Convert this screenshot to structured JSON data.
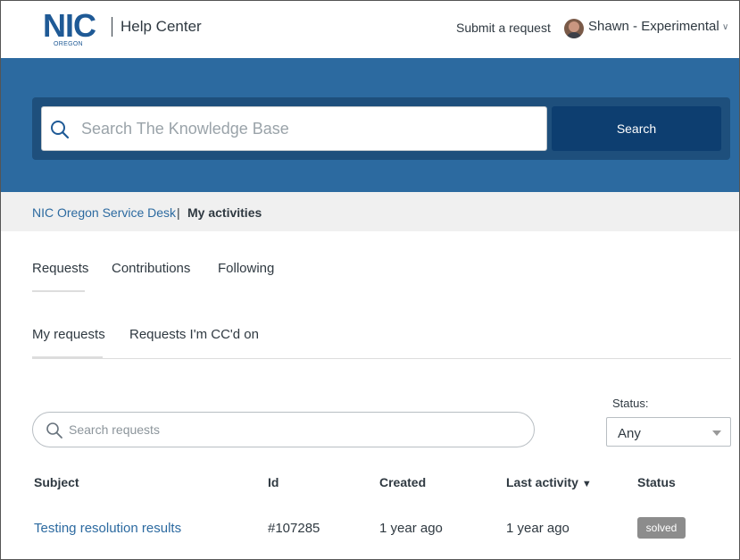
{
  "header": {
    "logo_text": "NIC",
    "logo_sub": "OREGON",
    "title": "Help Center",
    "submit_request": "Submit a request",
    "user_name": "Shawn - Experimental"
  },
  "hero": {
    "search_placeholder": "Search The Knowledge Base",
    "search_button": "Search"
  },
  "breadcrumb": {
    "parent": "NIC Oregon Service Desk",
    "separator": "|",
    "current": "My activities"
  },
  "tabs": [
    {
      "label": "Requests",
      "active": true
    },
    {
      "label": "Contributions",
      "active": false
    },
    {
      "label": "Following",
      "active": false
    }
  ],
  "subtabs": [
    {
      "label": "My requests",
      "active": true
    },
    {
      "label": "Requests I'm CC'd on",
      "active": false
    }
  ],
  "filter": {
    "search_placeholder": "Search requests",
    "status_label": "Status:",
    "status_value": "Any"
  },
  "table": {
    "columns": [
      "Subject",
      "Id",
      "Created",
      "Last activity",
      "Status"
    ],
    "sort_indicator": "▼",
    "rows": [
      {
        "subject": "Testing resolution results",
        "id": "#107285",
        "created": "1 year ago",
        "last_activity": "1 year ago",
        "status": "solved"
      }
    ]
  },
  "colors": {
    "brand_blue": "#2c6aa0",
    "dark_blue": "#0d3e70",
    "badge_gray": "#8c8c8c"
  }
}
